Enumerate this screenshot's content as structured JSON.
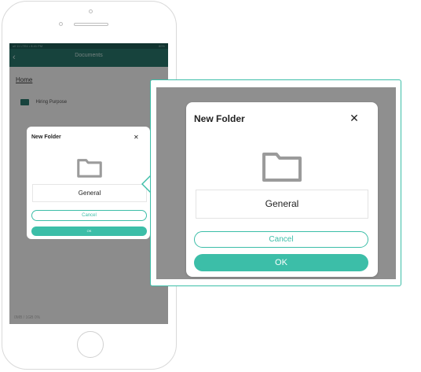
{
  "phone_screen": {
    "status_left": "ull 11 LTE4 • 8:41 PM",
    "status_right": "80%",
    "nav_title": "Documents",
    "breadcrumb": "Home",
    "folder_item": "Hiring Purpose",
    "storage": "0MB / 1GB 0%"
  },
  "dialog": {
    "title": "New Folder",
    "close_glyph": "✕",
    "folder_name_value": "General",
    "cancel_label": "Cancel",
    "ok_label": "OK"
  },
  "colors": {
    "accent": "#3cbea8",
    "nav_bar": "#2a7a70",
    "overlay": "#8f8f8f",
    "folder_icon": "#9b9b9b"
  },
  "icons": {
    "back": "chevron-left-icon",
    "close": "close-icon",
    "folder": "folder-icon",
    "new_folder_tab": "folder-add-icon",
    "upload_tab": "cloud-upload-icon"
  }
}
